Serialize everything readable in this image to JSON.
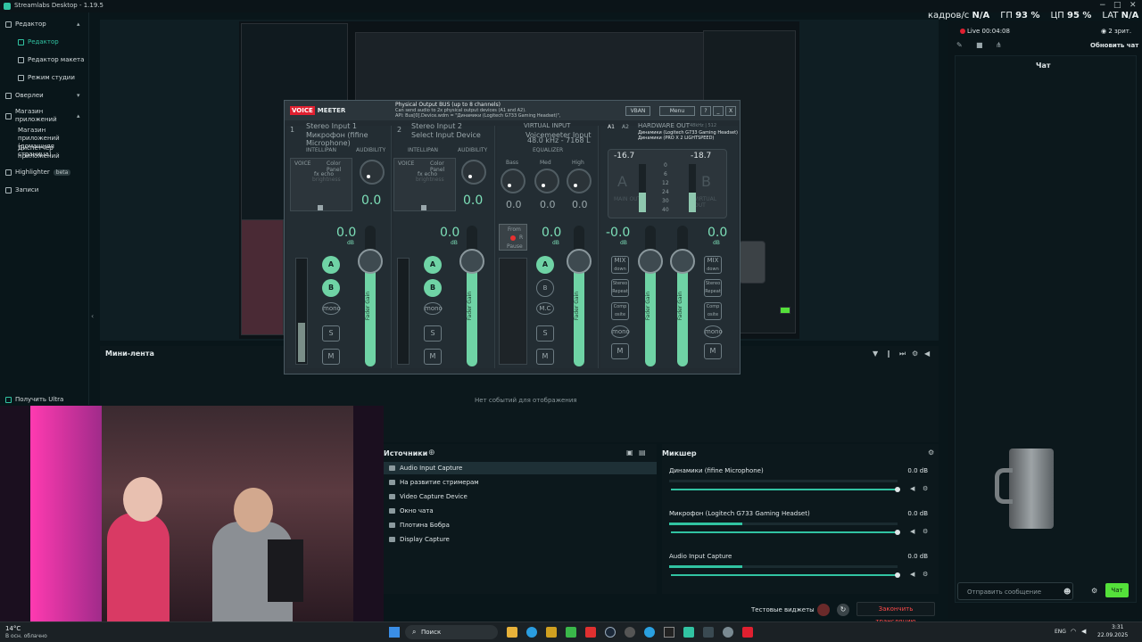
{
  "app": {
    "title": "Streamlabs Desktop - 1.19.5"
  },
  "stats": {
    "fps_label": "кадров/с",
    "fps": "N/A",
    "gpu_label": "ГП",
    "gpu": "93 %",
    "cpu_label": "ЦП",
    "cpu": "95 %",
    "lat_label": "LAT",
    "lat": "N/A"
  },
  "sidebar": {
    "editor_group": "Редактор",
    "editor": "Редактор",
    "layout_editor": "Редактор макета",
    "studio_mode": "Режим студии",
    "overlays": "Оверлеи",
    "app_store": "Магазин приложений",
    "app_store_home": "Магазин приложений (домашняя страница)",
    "app_manager": "Диспетчер приложений",
    "highlighter": "Highlighter",
    "beta": "beta",
    "recordings": "Записи",
    "get_ultra": "Получить Ultra"
  },
  "right": {
    "live": "Live 00:04:08",
    "viewers": "2 зрит.",
    "refresh_chat": "Обновить чат",
    "chat_title": "Чат",
    "message_placeholder": "Отправить сообщение",
    "chat_button": "Чат"
  },
  "mini": {
    "title": "Мини-лента",
    "empty": "Нет событий для отображения"
  },
  "sources": {
    "title": "Источники",
    "items": [
      "Audio Input Capture",
      "На развитие стримерам",
      "Video Capture Device",
      "Окно чата",
      "Плотина Бобра",
      "Display Capture"
    ]
  },
  "mixer": {
    "title": "Микшер",
    "items": [
      {
        "name": "Динамики (fifine Microphone)",
        "db": "0.0 dB",
        "level": 0
      },
      {
        "name": "Микрофон (Logitech G733 Gaming Headset)",
        "db": "0.0 dB",
        "level": 0.32
      },
      {
        "name": "Audio Input Capture",
        "db": "0.0 dB",
        "level": 0.32
      }
    ]
  },
  "bottom": {
    "test_widgets": "Тестовые виджеты",
    "end_stream": "Закончить трансляцию"
  },
  "weather": {
    "temp": "14°C",
    "desc": "В осн. облачно"
  },
  "taskbar": {
    "search": "Поиск",
    "lang": "ENG",
    "time": "3:31",
    "date": "22.09.2025"
  },
  "vm": {
    "logo_a": "VOICE",
    "logo_b": "MEETER",
    "info1": "Physical Output BUS (up to 8 channels)",
    "info2": "Can send audio to 2x physical output devices (A1 and A2).",
    "info3": "API: Bus[0].Device.wdm = \"Динамики (Logitech G733 Gaming Headset)\",",
    "vban": "VBAN",
    "menu": "Menu",
    "help": "?",
    "min": "_",
    "close": "X",
    "in1_num": "1",
    "in1": "Stereo Input 1",
    "in1_dev": "Микрофон (fifine Microphone)",
    "in2_num": "2",
    "in2": "Stereo Input 2",
    "in2_dev": "Select Input Device",
    "vinput": "VIRTUAL INPUT",
    "vinput_dev": "Voicemeeter Input",
    "vinput_info": "48.0 kHz - 7168 L",
    "hw_out": "HARDWARE OUT",
    "hw_info": "48kHz | 512",
    "hw1": "Динамики (Logitech G733 Gaming Headset)",
    "hw2": "Динамики (PRO X 2 LIGHTSPEED)",
    "a1": "A1",
    "a2": "A2",
    "intellipan": "INTELLIPAN",
    "audibility": "AUDIBILITY",
    "voice": "VOICE",
    "color_panel": "Color Panel",
    "fx_echo": "fx echo",
    "brightness": "brightness",
    "eq": "EQUALIZER",
    "bass": "Bass",
    "med": "Med",
    "high": "High",
    "aud1": "0.0",
    "aud2": "0.0",
    "eq_bass": "0.0",
    "eq_med": "0.0",
    "eq_high": "0.0",
    "db": "dB",
    "out_a": "-16.7",
    "out_b": "-18.7",
    "a": "A",
    "b": "B",
    "main_out": "MAIN OUT",
    "virtual_out": "VIRTUAL OUT",
    "fader_label": "Fader Gain",
    "gain1": "0.0",
    "gain2": "0.0",
    "gain3": "0.0",
    "gain4": "-0.0",
    "gain5": "0.0",
    "mono": "mono",
    "mc": "M.C",
    "s": "S",
    "m": "M",
    "mix": "MIX",
    "down": "down",
    "stereo": "Stereo",
    "repeat": "Repeat",
    "comp": "Comp",
    "osite": "osite",
    "ticks": [
      "0",
      "6",
      "12",
      "24",
      "30",
      "40"
    ],
    "rec_from": "From",
    "rec_r": "R",
    "rec_pause": "Pause"
  }
}
